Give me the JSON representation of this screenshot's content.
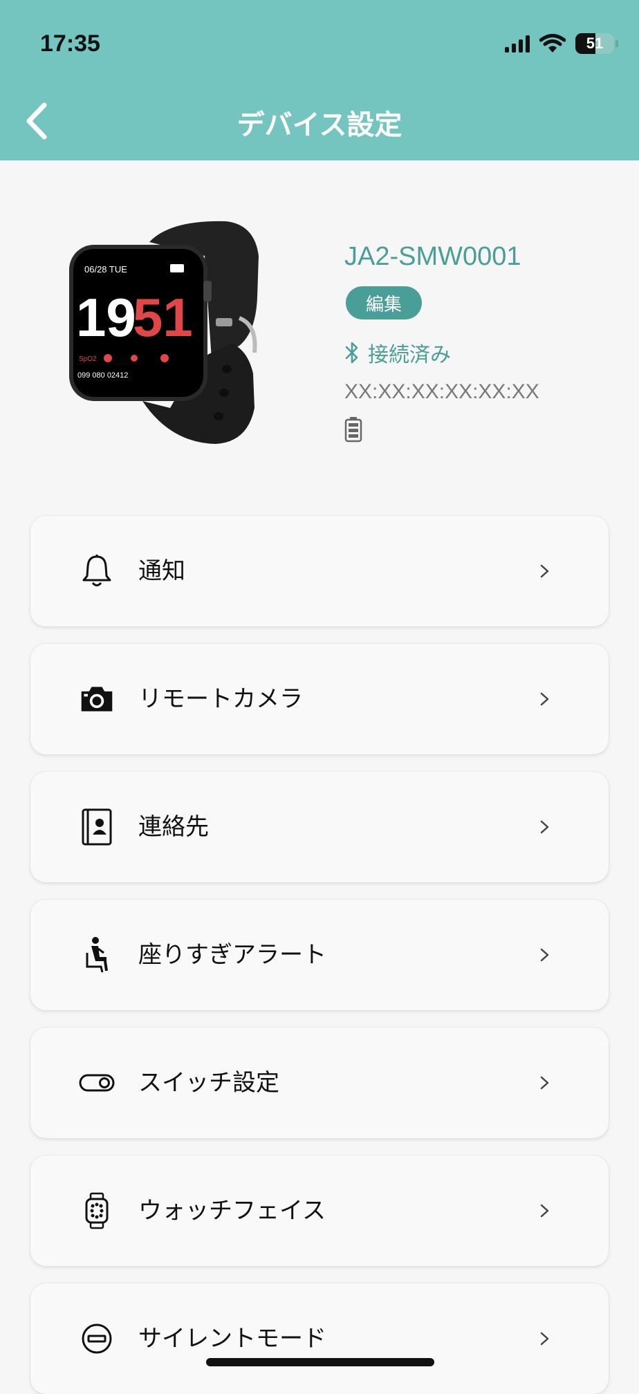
{
  "status_bar": {
    "time": "17:35",
    "battery": "51"
  },
  "header": {
    "title": "デバイス設定",
    "back_icon": "chevron-left-icon"
  },
  "device": {
    "name": "JA2-SMW0001",
    "edit_label": "編集",
    "connection_status": "接続済み",
    "mac_address": "XX:XX:XX:XX:XX:XX",
    "watch_face": {
      "date": "06/28 TUE",
      "hour": "19",
      "minute": "51",
      "stats": "099  080  02412",
      "spo2": "SpO2"
    }
  },
  "menu": {
    "items": [
      {
        "label": "通知",
        "icon": "bell-icon"
      },
      {
        "label": "リモートカメラ",
        "icon": "camera-icon"
      },
      {
        "label": "連絡先",
        "icon": "contacts-icon"
      },
      {
        "label": "座りすぎアラート",
        "icon": "sitting-person-icon"
      },
      {
        "label": "スイッチ設定",
        "icon": "toggle-switch-icon"
      },
      {
        "label": "ウォッチフェイス",
        "icon": "watch-icon"
      },
      {
        "label": "サイレントモード",
        "icon": "do-not-disturb-icon"
      }
    ]
  },
  "colors": {
    "header": "#74c4bf",
    "accent": "#4a9e98",
    "background": "#f6f6f6"
  }
}
